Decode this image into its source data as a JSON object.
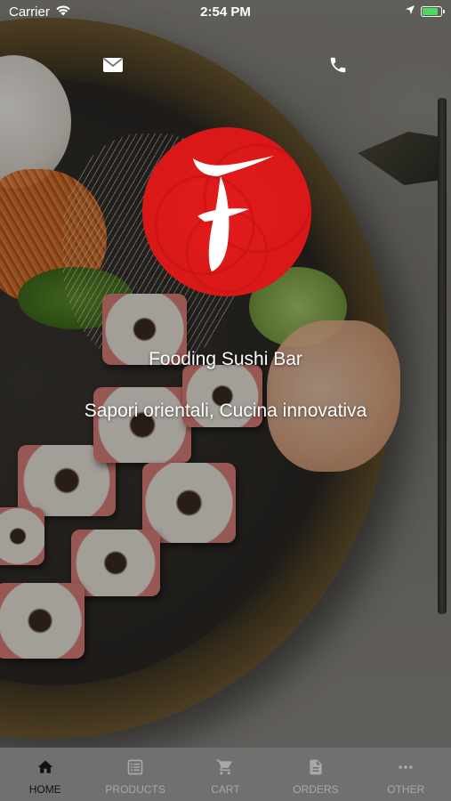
{
  "status_bar": {
    "carrier": "Carrier",
    "time": "2:54 PM",
    "battery_level": 0.85,
    "battery_color": "#4cd964"
  },
  "header": {
    "left_icon": "mail-icon",
    "right_icon": "phone-icon"
  },
  "hero": {
    "logo_letter": "F",
    "logo_color": "#d51717",
    "title": "Fooding Sushi Bar",
    "subtitle": "Sapori orientali, Cucina innovativa"
  },
  "tab_bar": {
    "background": "#707070",
    "active_color": "#111111",
    "inactive_color": "#a8a8a8",
    "tabs": [
      {
        "label": "HOME",
        "icon": "home-icon",
        "active": true
      },
      {
        "label": "PRODUCTS",
        "icon": "menu-list-icon",
        "active": false
      },
      {
        "label": "CART",
        "icon": "cart-icon",
        "active": false
      },
      {
        "label": "ORDERS",
        "icon": "document-icon",
        "active": false
      },
      {
        "label": "OTHER",
        "icon": "more-icon",
        "active": false
      }
    ]
  }
}
